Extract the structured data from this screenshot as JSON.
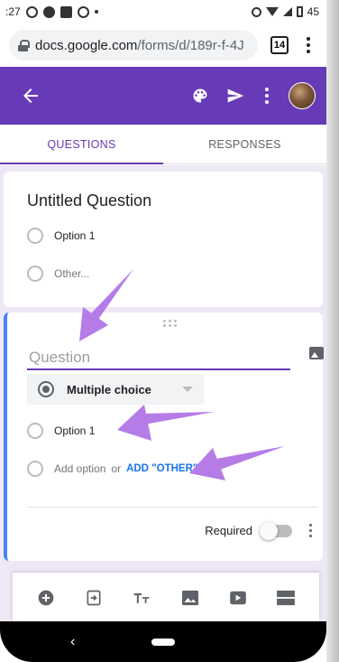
{
  "status_bar": {
    "time": ":27",
    "battery": "45"
  },
  "browser": {
    "url_host": "docs.google.com",
    "url_path": "/forms/d/189r-f-4J",
    "tab_count": "14"
  },
  "app": {
    "accent_color": "#673ab7"
  },
  "tabs": [
    {
      "label": "QUESTIONS",
      "active": true
    },
    {
      "label": "RESPONSES",
      "active": false
    }
  ],
  "question1": {
    "title": "Untitled Question",
    "options": [
      "Option 1",
      "Other..."
    ]
  },
  "question2": {
    "title_placeholder": "Question",
    "type_label": "Multiple choice",
    "options": [
      "Option 1"
    ],
    "add_option_label": "Add option",
    "or_label": "or",
    "add_other_label": "ADD \"OTHER\"",
    "required_label": "Required"
  },
  "annotation_color": "#b57ce8"
}
